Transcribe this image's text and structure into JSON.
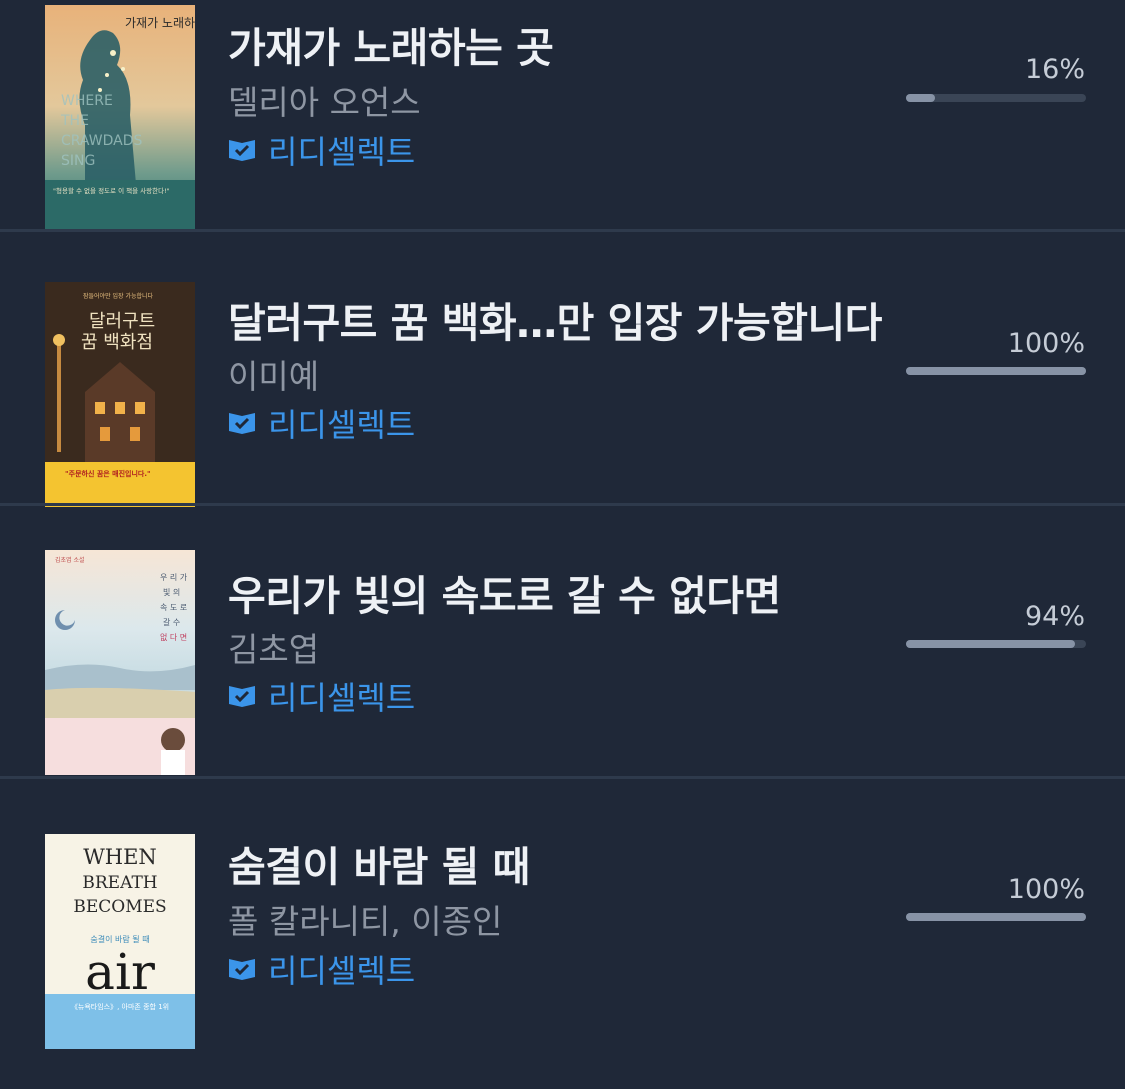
{
  "badge_icon": "check-book-icon",
  "colors": {
    "background": "#1f2838",
    "title": "#eef1f5",
    "author": "#8e96a3",
    "badge": "#3b95ea",
    "progress_track": "#3a4556",
    "progress_fill": "#8793a6"
  },
  "books": [
    {
      "title": "가재가 노래하는 곳",
      "author": "델리아 오언스",
      "badge": "리디셀렉트",
      "percent_label": "16%",
      "progress": 0.16,
      "cover": {
        "title_ko": "가재가 노래하는 곳",
        "title_en": [
          "WHERE",
          "THE",
          "CRAWDADS",
          "SING"
        ],
        "quote": "\"형용할 수 없을 정도로 이 책을 사랑한다!\""
      }
    },
    {
      "title": "달러구트 꿈 백화…만 입장 가능합니다",
      "author": "이미예",
      "badge": "리디셀렉트",
      "percent_label": "100%",
      "progress": 1.0,
      "cover": {
        "top_banner": "잠들어야만 입장 가능합니다",
        "title_line1": "달러구트",
        "title_line2": "꿈 백화점",
        "bottom_banner": "\"주문하신 꿈은 매진입니다.\""
      }
    },
    {
      "title": "우리가 빛의 속도로 갈 수 없다면",
      "author": "김초엽",
      "badge": "리디셀렉트",
      "percent_label": "94%",
      "progress": 0.94,
      "cover": {
        "vertical_title": [
          "우 리 가",
          "빛 의",
          "속 도 로",
          "갈 수",
          "없 다 면"
        ],
        "label": "김초엽 소설"
      }
    },
    {
      "title": "숨결이 바람 될 때",
      "author": "폴 칼라니티, 이종인",
      "badge": "리디셀렉트",
      "percent_label": "100%",
      "progress": 1.0,
      "cover": {
        "title_en": [
          "WHEN",
          "BREATH",
          "BECOMES"
        ],
        "big_word": "air",
        "title_ko": "숨결이 바람 될 때",
        "banner": "《뉴욕타임스》, 아마존 종합 1위"
      }
    }
  ]
}
